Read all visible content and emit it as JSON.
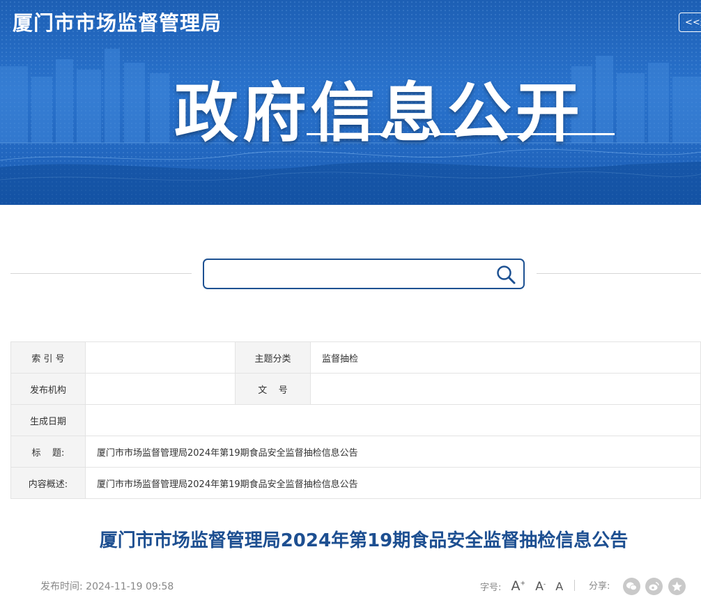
{
  "header": {
    "site_name": "厦门市市场监督管理局",
    "back_label": "<<返回",
    "banner_title": "政府信息公开"
  },
  "search": {
    "placeholder": "",
    "value": ""
  },
  "meta": {
    "index_label": "索 引 号",
    "index_value": "",
    "topic_label": "主题分类",
    "topic_value": "监督抽检",
    "publisher_label": "发布机构",
    "publisher_value": "",
    "docno_label": "文    号",
    "docno_value": "",
    "date_label": "生成日期",
    "date_value": "",
    "title_label": "标    题:",
    "title_value": "厦门市市场监督管理局2024年第19期食品安全监督抽检信息公告",
    "summary_label": "内容概述:",
    "summary_value": "厦门市市场监督管理局2024年第19期食品安全监督抽检信息公告"
  },
  "article": {
    "title": "厦门市市场监督管理局2024年第19期食品安全监督抽检信息公告",
    "publish_label": "发布时间:",
    "publish_time": "2024-11-19 09:58",
    "font_label": "字号:",
    "font_large": "A",
    "font_medium": "A",
    "font_small": "A",
    "share_label": "分享:"
  },
  "icons": [
    "search-icon",
    "wechat-icon",
    "weibo-icon",
    "favorite-icon"
  ],
  "colors": {
    "brand_blue": "#1d5fb4",
    "title_blue": "#1d4f91"
  }
}
